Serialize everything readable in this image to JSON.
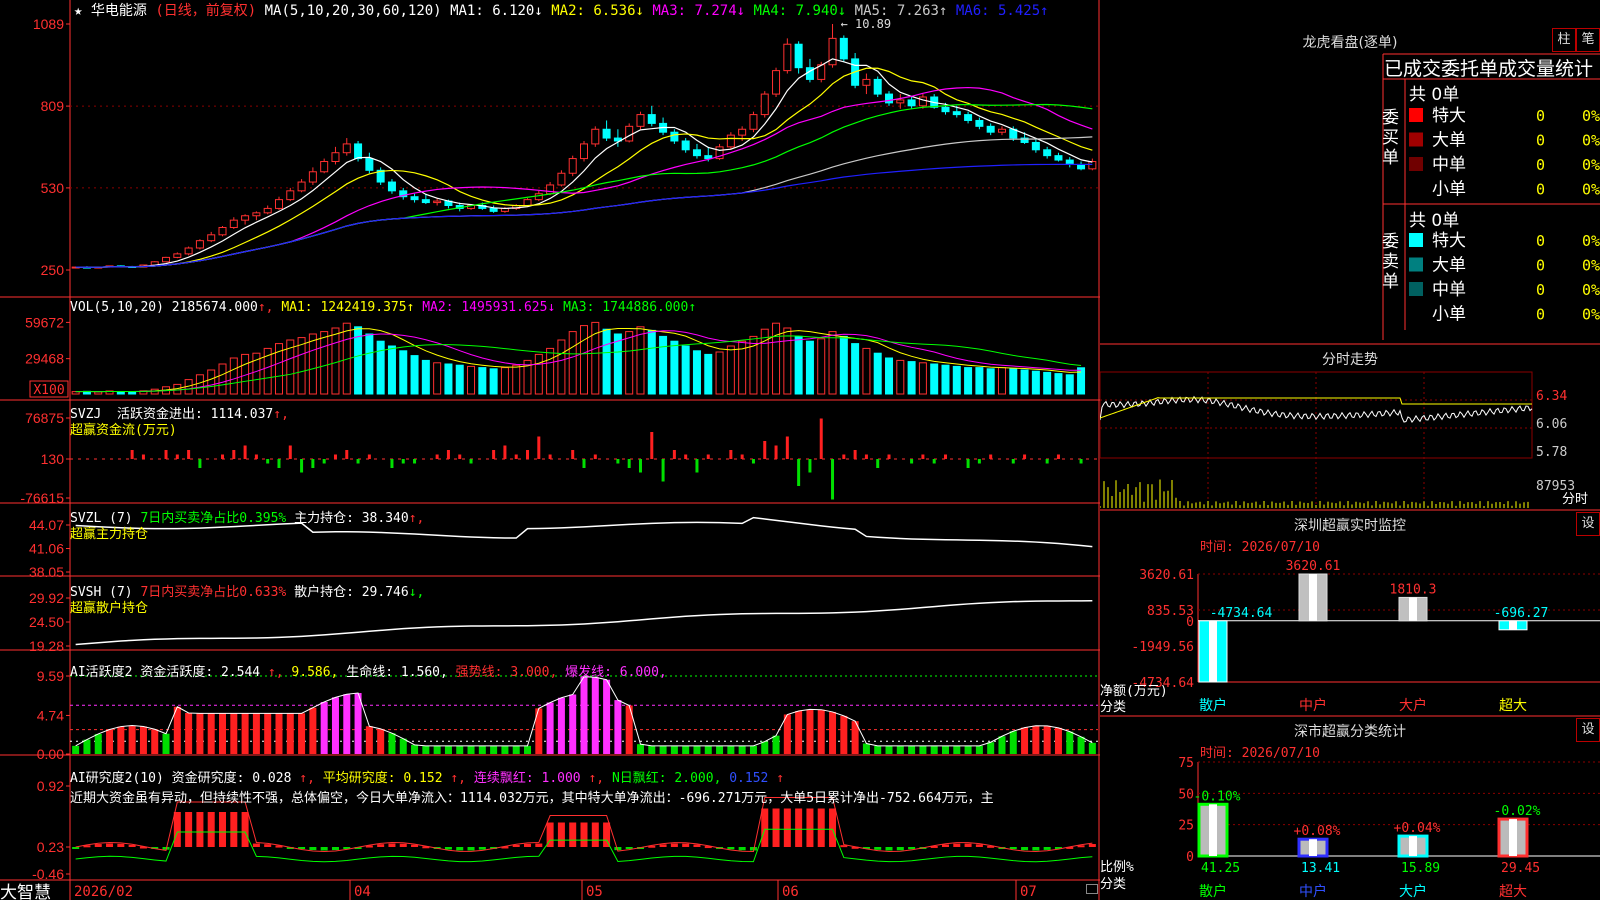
{
  "header": {
    "star": "★",
    "stock_name": "华电能源",
    "period": "(日线，前复权)",
    "ma_label": "MA(5,10,20,30,60,120)",
    "ma": [
      {
        "label": "MA1: 6.120",
        "arrow": "↓",
        "color": "#ffffff"
      },
      {
        "label": "MA2: 6.536",
        "arrow": "↓",
        "color": "#ffff00"
      },
      {
        "label": "MA3: 7.274",
        "arrow": "↓",
        "color": "#ff00ff"
      },
      {
        "label": "MA4: 7.940",
        "arrow": "↓",
        "color": "#00ff00"
      },
      {
        "label": "MA5: 7.263",
        "arrow": "↑",
        "color": "#c8c8c8"
      },
      {
        "label": "MA6: 5.425",
        "arrow": "↑",
        "color": "#2020ff"
      }
    ],
    "high_mark": "10.89"
  },
  "price_panel": {
    "y_ticks": [
      "1089",
      "809",
      "530",
      "250"
    ]
  },
  "vol_panel": {
    "title": "VOL(5,10,20)",
    "value": "2185674.000",
    "ma": [
      {
        "label": "MA1: 1242419.375",
        "arrow": "↑",
        "color": "#ffff00"
      },
      {
        "label": "MA2: 1495931.625",
        "arrow": "↓",
        "color": "#ff00ff"
      },
      {
        "label": "MA3: 1744886.000",
        "arrow": "↑",
        "color": "#00ff00"
      }
    ],
    "y_ticks": [
      "59672",
      "29468"
    ],
    "unit": "X100"
  },
  "svzj_panel": {
    "title": "SVZJ",
    "name": "活跃资金进出: 1114.037",
    "arrow": "↑,",
    "subtitle": "超赢资金流(万元)",
    "y_ticks": [
      "76875",
      "130",
      "-76615"
    ]
  },
  "svzl_panel": {
    "title": "SVZL (7)",
    "stat": "7日内买卖净占比0.395%",
    "main_label": "主力持仓: 38.340",
    "arrow": "↑,",
    "subtitle": "超赢主力持仓",
    "y_ticks": [
      "44.07",
      "41.06",
      "38.05"
    ]
  },
  "svsh_panel": {
    "title": "SVSH (7)",
    "stat": "7日内买卖净占比0.633%",
    "main_label": "散户持仓: 29.746",
    "arrow": "↓,",
    "subtitle": "超赢散户持仓",
    "y_ticks": [
      "29.92",
      "24.50",
      "19.28"
    ]
  },
  "ai_panel": {
    "title": "AI活跃度2",
    "items": [
      {
        "text": "资金活跃度: 2.544",
        "color": "#ffffff"
      },
      {
        "text": "↑,",
        "color": "#ff3030"
      },
      {
        "text": "9.586,",
        "color": "#ffff00"
      },
      {
        "text": "生命线: 1.560,",
        "color": "#ffffff"
      },
      {
        "text": "强势线: 3.000,",
        "color": "#ff3030"
      },
      {
        "text": "爆发线: 6.000,",
        "color": "#ff30ff"
      }
    ],
    "y_ticks": [
      "9.59",
      "4.74",
      "0.00"
    ]
  },
  "research_panel": {
    "title": "AI研究度2(10)",
    "items": [
      {
        "text": "资金研究度: 0.028",
        "color": "#ffffff"
      },
      {
        "text": "↑,",
        "color": "#ff3030"
      },
      {
        "text": "平均研究度: 0.152",
        "color": "#ffff00"
      },
      {
        "text": "↑,",
        "color": "#ff3030"
      },
      {
        "text": "连续飘红: 1.000",
        "color": "#ff30ff"
      },
      {
        "text": "↑,",
        "color": "#ff3030"
      },
      {
        "text": "N日飘红: 2.000,",
        "color": "#00ff00"
      },
      {
        "text": "0.152",
        "color": "#3050ff"
      },
      {
        "text": "↑",
        "color": "#ff3030"
      }
    ],
    "comment": "近期大资金虽有异动，但持续性不强，总体偏空，今日大单净流入：1114.032万元，其中特大单净流出：-696.271万元，大单5日累计净出-752.664万元，主",
    "y_ticks": [
      "0.92",
      "0.23",
      "-0.46"
    ]
  },
  "bottom_bar": {
    "brand": "大智慧",
    "dates": [
      "2026/02",
      "04",
      "05",
      "06",
      "07"
    ]
  },
  "side": {
    "dragon_title": "龙虎看盘(逐单)",
    "btn_col": "柱",
    "btn_bi": "笔",
    "order_title": "已成交委托单成交量统计",
    "buy_label": "委买单",
    "sell_label": "委卖单",
    "buy_total": "共 0单",
    "sell_total": "共 0单",
    "buy_rows": [
      {
        "label": "特大",
        "value": "0",
        "pct": "0%",
        "color": "#ff0000"
      },
      {
        "label": "大单",
        "value": "0",
        "pct": "0%",
        "color": "#a00000"
      },
      {
        "label": "中单",
        "value": "0",
        "pct": "0%",
        "color": "#700000"
      },
      {
        "label": "小单",
        "value": "0",
        "pct": "0%",
        "color": ""
      }
    ],
    "sell_rows": [
      {
        "label": "特大",
        "value": "0",
        "pct": "0%",
        "color": "#00ffff"
      },
      {
        "label": "大单",
        "value": "0",
        "pct": "0%",
        "color": "#008080"
      },
      {
        "label": "中单",
        "value": "0",
        "pct": "0%",
        "color": "#006060"
      },
      {
        "label": "小单",
        "value": "0",
        "pct": "0%",
        "color": ""
      }
    ],
    "intraday_title": "分时走势",
    "intraday_ticks": [
      "6.34",
      "6.06",
      "5.78"
    ],
    "intraday_vol": "87953",
    "intraday_unit": "分时",
    "monitor_title": "深圳超赢实时监控",
    "monitor_date": "时间: 2026/07/10",
    "set_label": "设",
    "monitor_ticks": [
      "3620.61",
      "835.53",
      "0",
      "-1949.56",
      "-4734.64"
    ],
    "monitor_ylabel": "净额(万元)",
    "monitor_xlabel": "分类",
    "cats": [
      "散户",
      "中户",
      "大户",
      "超大"
    ],
    "class_title": "深市超赢分类统计",
    "class_date": "时间: 2026/07/10",
    "class_ticks": [
      "75",
      "50",
      "25",
      "0"
    ],
    "class_ylabel": "比例%",
    "class_xlabel": "分类"
  },
  "colors": {
    "up": "#ff3030",
    "down": "#00ffff",
    "grid": "#8b0000",
    "axis": "#ff3030"
  },
  "chart_data": [
    {
      "type": "candlestick",
      "name": "price",
      "ylim": [
        2.5,
        10.89
      ],
      "ma_lines": [
        "MA1",
        "MA2",
        "MA3",
        "MA4",
        "MA5",
        "MA6"
      ],
      "ohlc": [
        [
          2.58,
          2.62,
          2.55,
          2.6
        ],
        [
          2.6,
          2.63,
          2.57,
          2.59
        ],
        [
          2.59,
          2.61,
          2.56,
          2.6
        ],
        [
          2.6,
          2.65,
          2.58,
          2.64
        ],
        [
          2.64,
          2.66,
          2.6,
          2.62
        ],
        [
          2.62,
          2.64,
          2.58,
          2.6
        ],
        [
          2.6,
          2.68,
          2.59,
          2.67
        ],
        [
          2.67,
          2.8,
          2.66,
          2.78
        ],
        [
          2.78,
          2.95,
          2.76,
          2.93
        ],
        [
          2.93,
          3.1,
          2.9,
          3.05
        ],
        [
          3.05,
          3.3,
          3.0,
          3.25
        ],
        [
          3.25,
          3.55,
          3.2,
          3.5
        ],
        [
          3.5,
          3.8,
          3.45,
          3.7
        ],
        [
          3.7,
          4.0,
          3.65,
          3.95
        ],
        [
          3.95,
          4.3,
          3.9,
          4.2
        ],
        [
          4.2,
          4.4,
          4.05,
          4.35
        ],
        [
          4.35,
          4.5,
          4.2,
          4.45
        ],
        [
          4.45,
          4.7,
          4.4,
          4.6
        ],
        [
          4.6,
          5.0,
          4.55,
          4.9
        ],
        [
          4.9,
          5.3,
          4.85,
          5.2
        ],
        [
          5.2,
          5.6,
          5.15,
          5.5
        ],
        [
          5.5,
          6.0,
          5.4,
          5.85
        ],
        [
          5.85,
          6.3,
          5.8,
          6.2
        ],
        [
          6.2,
          6.7,
          6.1,
          6.5
        ],
        [
          6.5,
          7.0,
          6.4,
          6.8
        ],
        [
          6.8,
          6.9,
          6.2,
          6.3
        ],
        [
          6.3,
          6.5,
          5.8,
          5.9
        ],
        [
          5.9,
          6.0,
          5.4,
          5.5
        ],
        [
          5.5,
          5.6,
          5.1,
          5.2
        ],
        [
          5.2,
          5.3,
          4.9,
          5.0
        ],
        [
          5.0,
          5.1,
          4.8,
          4.9
        ],
        [
          4.9,
          5.1,
          4.75,
          4.8
        ],
        [
          4.8,
          4.95,
          4.7,
          4.85
        ],
        [
          4.85,
          4.9,
          4.6,
          4.7
        ],
        [
          4.7,
          4.8,
          4.5,
          4.6
        ],
        [
          4.6,
          4.75,
          4.55,
          4.7
        ],
        [
          4.7,
          4.8,
          4.55,
          4.6
        ],
        [
          4.6,
          4.7,
          4.45,
          4.5
        ],
        [
          4.5,
          4.65,
          4.45,
          4.6
        ],
        [
          4.6,
          4.75,
          4.55,
          4.7
        ],
        [
          4.7,
          4.95,
          4.65,
          4.9
        ],
        [
          4.9,
          5.2,
          4.85,
          5.1
        ],
        [
          5.1,
          5.5,
          5.05,
          5.4
        ],
        [
          5.4,
          5.9,
          5.35,
          5.8
        ],
        [
          5.8,
          6.4,
          5.7,
          6.3
        ],
        [
          6.3,
          6.9,
          6.2,
          6.8
        ],
        [
          6.8,
          7.4,
          6.7,
          7.3
        ],
        [
          7.3,
          7.6,
          6.9,
          7.0
        ],
        [
          7.0,
          7.3,
          6.7,
          6.9
        ],
        [
          6.9,
          7.5,
          6.85,
          7.4
        ],
        [
          7.4,
          7.9,
          7.3,
          7.8
        ],
        [
          7.8,
          8.1,
          7.4,
          7.5
        ],
        [
          7.5,
          7.7,
          7.1,
          7.2
        ],
        [
          7.2,
          7.3,
          6.8,
          6.9
        ],
        [
          6.9,
          7.0,
          6.5,
          6.6
        ],
        [
          6.6,
          6.8,
          6.3,
          6.4
        ],
        [
          6.4,
          6.7,
          6.2,
          6.3
        ],
        [
          6.3,
          6.8,
          6.25,
          6.7
        ],
        [
          6.7,
          7.2,
          6.6,
          7.1
        ],
        [
          7.1,
          7.4,
          6.9,
          7.3
        ],
        [
          7.3,
          7.9,
          7.2,
          7.8
        ],
        [
          7.8,
          8.6,
          7.7,
          8.5
        ],
        [
          8.5,
          9.4,
          8.4,
          9.3
        ],
        [
          9.3,
          10.4,
          9.2,
          10.2
        ],
        [
          10.2,
          10.3,
          9.2,
          9.4
        ],
        [
          9.4,
          9.7,
          8.9,
          9.0
        ],
        [
          9.0,
          9.6,
          8.9,
          9.5
        ],
        [
          9.5,
          10.89,
          9.4,
          10.4
        ],
        [
          10.4,
          10.5,
          9.6,
          9.7
        ],
        [
          9.7,
          9.9,
          8.7,
          8.8
        ],
        [
          8.8,
          9.2,
          8.5,
          9.0
        ],
        [
          9.0,
          9.1,
          8.4,
          8.5
        ],
        [
          8.5,
          8.6,
          8.1,
          8.2
        ],
        [
          8.2,
          8.5,
          8.0,
          8.3
        ],
        [
          8.3,
          8.4,
          8.0,
          8.1
        ],
        [
          8.1,
          8.5,
          8.0,
          8.4
        ],
        [
          8.4,
          8.5,
          8.0,
          8.05
        ],
        [
          8.05,
          8.2,
          7.8,
          7.9
        ],
        [
          7.9,
          8.1,
          7.7,
          7.8
        ],
        [
          7.8,
          7.9,
          7.5,
          7.6
        ],
        [
          7.6,
          7.7,
          7.3,
          7.4
        ],
        [
          7.4,
          7.5,
          7.1,
          7.2
        ],
        [
          7.2,
          7.4,
          7.1,
          7.3
        ],
        [
          7.3,
          7.4,
          6.9,
          7.0
        ],
        [
          7.0,
          7.2,
          6.8,
          6.85
        ],
        [
          6.85,
          6.95,
          6.5,
          6.6
        ],
        [
          6.6,
          6.7,
          6.3,
          6.4
        ],
        [
          6.4,
          6.5,
          6.2,
          6.25
        ],
        [
          6.25,
          6.35,
          6.0,
          6.1
        ],
        [
          6.1,
          6.2,
          5.9,
          5.95
        ],
        [
          5.95,
          6.3,
          5.9,
          6.2
        ]
      ]
    },
    {
      "type": "bar",
      "name": "volume",
      "ylim": [
        0,
        65000
      ],
      "values": [
        2000,
        2200,
        1800,
        2500,
        2100,
        1900,
        2600,
        4000,
        6000,
        8000,
        12000,
        16000,
        20000,
        25000,
        30000,
        33000,
        34000,
        38000,
        42000,
        45000,
        47000,
        50000,
        52000,
        55000,
        59000,
        56000,
        50000,
        44000,
        40000,
        36000,
        32000,
        28000,
        26000,
        25000,
        24000,
        23000,
        22000,
        21000,
        22000,
        24000,
        28000,
        33000,
        38000,
        45000,
        52000,
        57000,
        59672,
        54000,
        50000,
        52000,
        56000,
        53000,
        48000,
        44000,
        40000,
        36000,
        33000,
        35000,
        40000,
        44000,
        48000,
        54000,
        59000,
        55000,
        48000,
        44000,
        46000,
        52000,
        48000,
        42000,
        38000,
        34000,
        30000,
        28000,
        27000,
        26000,
        25000,
        24000,
        23000,
        22000,
        22000,
        21000,
        22000,
        21000,
        20000,
        19000,
        18000,
        17000,
        16000,
        21856
      ]
    },
    {
      "type": "bar",
      "name": "svzj",
      "ylim": [
        -76615,
        76875
      ],
      "values": [
        0,
        0,
        0,
        0,
        0,
        0,
        0,
        0,
        0,
        0,
        0,
        0,
        0,
        0,
        0,
        0,
        0,
        0,
        0,
        0,
        0,
        0,
        0,
        0,
        0,
        0,
        0,
        0,
        0,
        0,
        0,
        0,
        0,
        0,
        0,
        0,
        0,
        0,
        0,
        0,
        0,
        0,
        0,
        0,
        0,
        0,
        0,
        0,
        0,
        0,
        0,
        0,
        0,
        0,
        0,
        0,
        0,
        0,
        0,
        0,
        0,
        0,
        0,
        0,
        0,
        0,
        0,
        0,
        0,
        0,
        0,
        0,
        0,
        0,
        0,
        0,
        0,
        0,
        0,
        0,
        0,
        0,
        0,
        0,
        0,
        0,
        0,
        0,
        0,
        1114
      ]
    },
    {
      "type": "bar",
      "name": "client_net",
      "categories": [
        "散户",
        "中户",
        "大户",
        "超大"
      ],
      "values": [
        -4734.64,
        3620.61,
        1810.3,
        -696.27
      ],
      "ylim": [
        -4734.64,
        3620.61
      ]
    },
    {
      "type": "bar",
      "name": "client_ratio",
      "categories": [
        "散户",
        "中户",
        "大户",
        "超大"
      ],
      "values": [
        41.25,
        13.41,
        15.89,
        29.45
      ],
      "changes": [
        "-0.10%",
        "+0.08%",
        "+0.04%",
        "-0.02%"
      ],
      "ylim": [
        0,
        75
      ]
    }
  ]
}
